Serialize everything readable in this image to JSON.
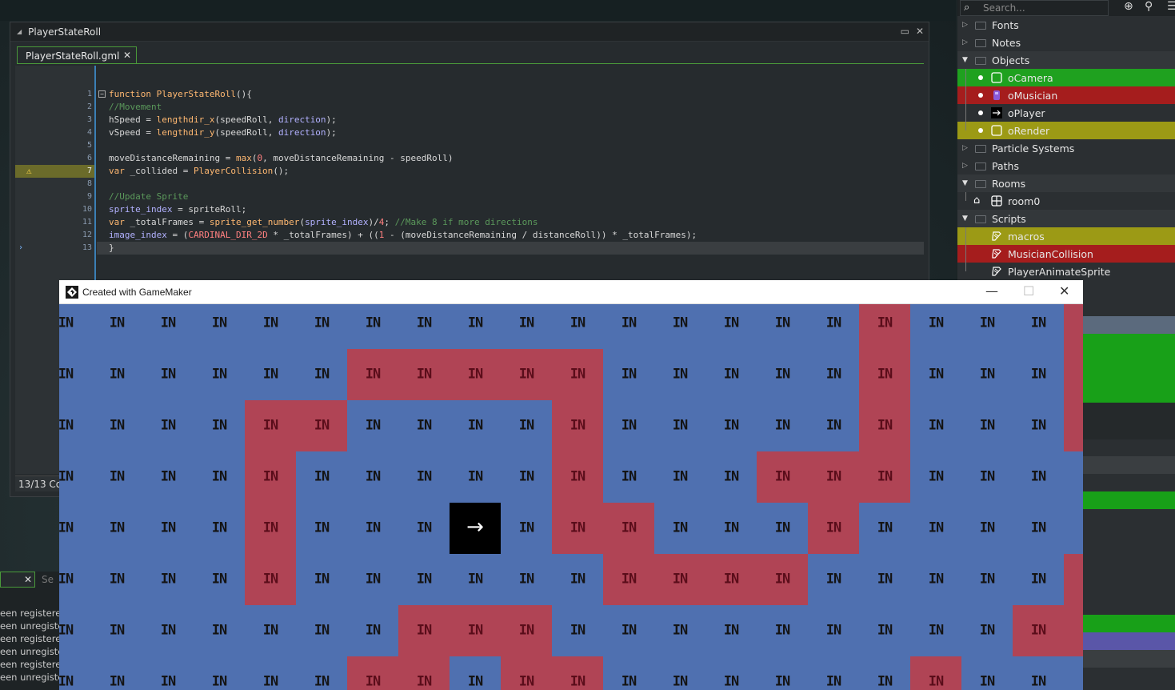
{
  "editor": {
    "window_title": "PlayerStateRoll",
    "tab_label": "PlayerStateRoll.gml",
    "status": "13/13 Co",
    "line_numbers": [
      "1",
      "2",
      "3",
      "4",
      "5",
      "6",
      "7",
      "8",
      "9",
      "10",
      "11",
      "12",
      "13"
    ],
    "lines": [
      "function PlayerStateRoll(){",
      "//Movement",
      "hSpeed = lengthdir_x(speedRoll, direction);",
      "vSpeed = lengthdir_y(speedRoll, direction);",
      "",
      "moveDistanceRemaining = max(0, moveDistanceRemaining - speedRoll)",
      "var _collided = PlayerCollision();",
      "",
      "//Update Sprite",
      "sprite_index = spriteRoll;",
      "var _totalFrames = sprite_get_number(sprite_index)/4; //Make 8 if more directions",
      "image_index = (CARDINAL_DIR_2D * _totalFrames) + ((1 - (moveDistanceRemaining / distanceRoll)) * _totalFrames);",
      "}"
    ],
    "warning_line": 7,
    "current_line": 13
  },
  "output": {
    "tab2": "Se",
    "lines": [
      "een registere",
      "een unregiste",
      "een registere",
      "een unregiste",
      "een registere",
      "een unregiste"
    ]
  },
  "tree": {
    "search_placeholder": "Search...",
    "items": [
      {
        "label": "Fonts",
        "type": "group"
      },
      {
        "label": "Notes",
        "type": "group"
      },
      {
        "label": "Objects",
        "type": "group-open"
      },
      {
        "label": "oCamera",
        "type": "object",
        "color": "#1fa11f"
      },
      {
        "label": "oMusician",
        "type": "object",
        "color": "#a51d1d"
      },
      {
        "label": "oPlayer",
        "type": "object",
        "color": ""
      },
      {
        "label": "oRender",
        "type": "object",
        "color": "#9c9a15"
      },
      {
        "label": "Particle Systems",
        "type": "group"
      },
      {
        "label": "Paths",
        "type": "group"
      },
      {
        "label": "Rooms",
        "type": "group-open"
      },
      {
        "label": "room0",
        "type": "room",
        "color": ""
      },
      {
        "label": "Scripts",
        "type": "group-open"
      },
      {
        "label": "macros",
        "type": "script",
        "color": "#9c9a15"
      },
      {
        "label": "MusicianCollision",
        "type": "script",
        "color": "#a51d1d"
      },
      {
        "label": "PlayerAnimateSprite",
        "type": "script",
        "color": ""
      }
    ]
  },
  "game": {
    "window_title": "Created with GameMaker",
    "tile_text": "IN",
    "player_glyph": "→",
    "colors": {
      "blue": "#4f70b0",
      "red": "#b04455"
    },
    "grid_rows": [
      "BBBBBBBBBBBBBBBBRBBBR",
      "BBBBBBRRRRRBBBBBRBBBR",
      "BBBBRRBBBBRBBBBBRBBBR",
      "BBBBRBBBBBRBBBRRRBBBB",
      "BBBBRBBBPBRRBBBRBBBBB",
      "BBBBRBBBBBBRRRRBBBBBR",
      "BBBBBBBRRRBBBBBBBBBRR",
      "BBBBBBRRBRRBBBBBBRBBB"
    ]
  }
}
